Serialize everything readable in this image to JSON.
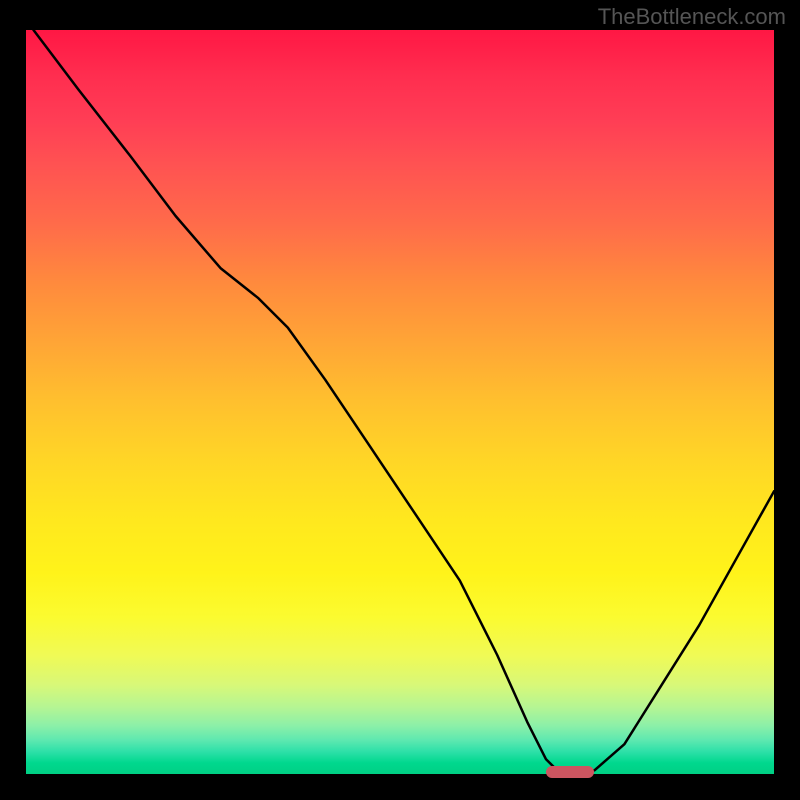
{
  "watermark_text": "TheBottleneck.com",
  "chart_data": {
    "type": "line",
    "title": "",
    "xlabel": "",
    "ylabel": "",
    "xlim": [
      0,
      100
    ],
    "ylim": [
      0,
      100
    ],
    "series": [
      {
        "name": "bottleneck-curve",
        "x": [
          1,
          7,
          14,
          20,
          26,
          31,
          35,
          40,
          46,
          52,
          58,
          63,
          67,
          69.5,
          71,
          74,
          76,
          80,
          85,
          90,
          95,
          100
        ],
        "y": [
          100,
          92,
          83,
          75,
          68,
          64,
          60,
          53,
          44,
          35,
          26,
          16,
          7,
          2,
          0.5,
          0.2,
          0.5,
          4,
          12,
          20,
          29,
          38
        ]
      }
    ],
    "marker": {
      "x_start": 69.5,
      "x_end": 76,
      "y": 0.3
    },
    "gradient_stops": [
      {
        "pos": 0,
        "color": "#ff1744"
      },
      {
        "pos": 50,
        "color": "#ffc02e"
      },
      {
        "pos": 80,
        "color": "#fbfb30"
      },
      {
        "pos": 100,
        "color": "#00d084"
      }
    ]
  }
}
